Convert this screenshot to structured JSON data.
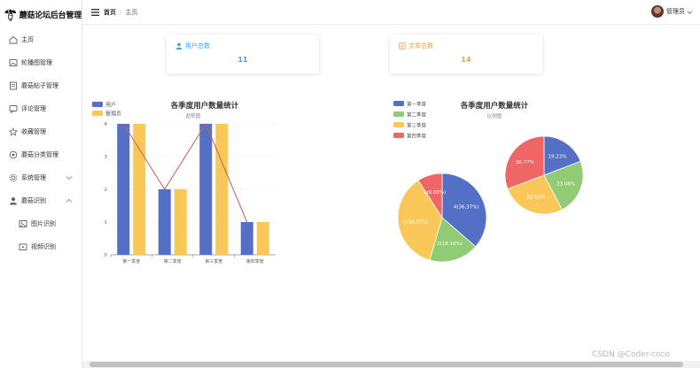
{
  "app": {
    "title": "蘑菇论坛后台管理"
  },
  "sidebar": {
    "items": [
      {
        "label": "主页",
        "icon": "home-icon"
      },
      {
        "label": "轮播图管理",
        "icon": "image-icon"
      },
      {
        "label": "蘑菇帖子管理",
        "icon": "document-icon"
      },
      {
        "label": "评论管理",
        "icon": "comment-icon"
      },
      {
        "label": "收藏管理",
        "icon": "star-icon"
      },
      {
        "label": "蘑菇分类管理",
        "icon": "category-icon"
      },
      {
        "label": "系统管理",
        "icon": "settings-icon",
        "expandable": true
      },
      {
        "label": "蘑菇识别",
        "icon": "user-icon",
        "expandable": true,
        "expanded": true
      }
    ],
    "subitems": [
      {
        "label": "图片识别",
        "icon": "picture-icon"
      },
      {
        "label": "视频识别",
        "icon": "video-icon"
      }
    ]
  },
  "header": {
    "breadcrumb_home": "首页",
    "breadcrumb_sep": "/",
    "breadcrumb_current": "主页",
    "username": "管理员"
  },
  "cards": [
    {
      "title": "用户总数",
      "value": "11",
      "color": "#409eff",
      "icon": "user-icon"
    },
    {
      "title": "文章总数",
      "value": "14",
      "color": "#e6a23c",
      "icon": "article-icon"
    }
  ],
  "colors": {
    "blue": "#5470c6",
    "green": "#91cc75",
    "yellow": "#fac858",
    "red": "#ee6666",
    "line": "#d05a5a"
  },
  "chart_data": [
    {
      "type": "bar",
      "title": "各季度用户数量统计",
      "subtitle": "趋势图",
      "categories": [
        "第一季度",
        "第二季度",
        "第三季度",
        "第四季度"
      ],
      "series": [
        {
          "name": "用户",
          "values": [
            4,
            2,
            4,
            1
          ]
        },
        {
          "name": "管理员",
          "values": [
            4,
            2,
            4,
            1
          ]
        }
      ],
      "line_overlay": [
        4,
        2,
        4,
        1
      ],
      "yticks": [
        "0",
        "1",
        "2",
        "3",
        "4"
      ],
      "ylim": [
        0,
        4
      ],
      "legend": "top-left"
    },
    {
      "type": "pie",
      "title": "各季度用户数量统计",
      "subtitle": "比例图",
      "legend": "top-left",
      "categories": [
        "第一季度",
        "第二季度",
        "第三季度",
        "第四季度"
      ],
      "pies": [
        {
          "values": [
            36.37,
            18.18,
            36.37,
            9.09
          ],
          "labels": [
            "4(36.37%)",
            "2(18.18%)",
            "4(36.37%)",
            "1(9.09%)"
          ]
        },
        {
          "values": [
            19.23,
            23.08,
            26.92,
            30.77
          ],
          "labels": [
            "19.23%",
            "23.08%",
            "26.92%",
            "30.77%"
          ]
        }
      ]
    }
  ],
  "watermark": "CSDN @Coder-coco"
}
